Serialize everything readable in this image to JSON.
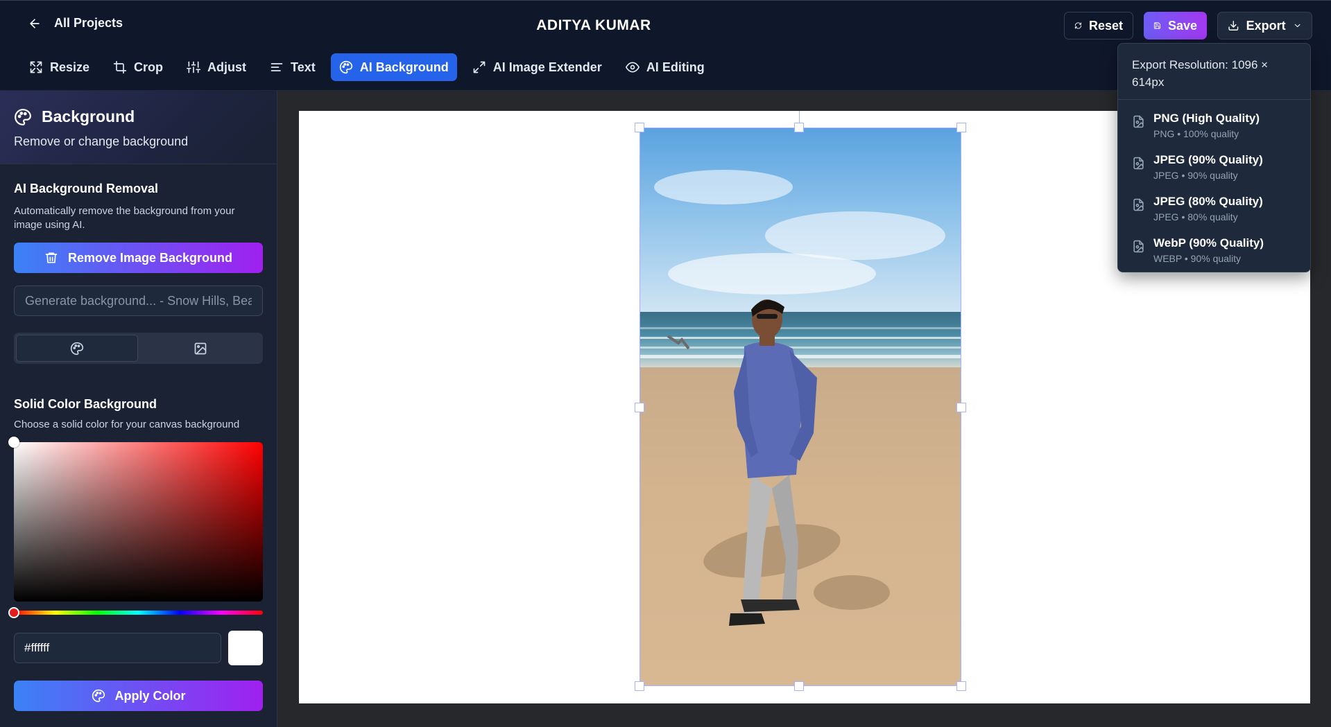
{
  "header": {
    "back_label": "All Projects",
    "project_title": "ADITYA KUMAR",
    "reset_label": "Reset",
    "save_label": "Save",
    "export_label": "Export"
  },
  "toolbar": {
    "tools": [
      {
        "label": "Resize",
        "icon": "resize-icon"
      },
      {
        "label": "Crop",
        "icon": "crop-icon"
      },
      {
        "label": "Adjust",
        "icon": "sliders-icon"
      },
      {
        "label": "Text",
        "icon": "text-icon"
      },
      {
        "label": "AI Background",
        "icon": "palette-icon",
        "active": true
      },
      {
        "label": "AI Image Extender",
        "icon": "expand-icon"
      },
      {
        "label": "AI Editing",
        "icon": "eye-icon"
      }
    ]
  },
  "sidebar": {
    "title": "Background",
    "subtitle": "Remove or change background",
    "removal": {
      "title": "AI Background Removal",
      "description": "Automatically remove the background from your image using AI.",
      "button_label": "Remove Image Background",
      "prompt_placeholder": "Generate background... - Snow Hills, Beach"
    },
    "solid": {
      "title": "Solid Color Background",
      "description": "Choose a solid color for your canvas background",
      "hex_value": "#ffffff",
      "swatch_color": "#ffffff",
      "apply_label": "Apply Color"
    }
  },
  "export_menu": {
    "resolution": "Export Resolution: 1096 × 614px",
    "options": [
      {
        "label": "PNG (High Quality)",
        "sub": "PNG • 100% quality"
      },
      {
        "label": "JPEG (90% Quality)",
        "sub": "JPEG • 90% quality"
      },
      {
        "label": "JPEG (80% Quality)",
        "sub": "JPEG • 80% quality"
      },
      {
        "label": "WebP (90% Quality)",
        "sub": "WEBP • 90% quality"
      }
    ]
  },
  "colors": {
    "accent": "#2563eb",
    "save_gradient": [
      "#6d5cf5",
      "#a338f0"
    ],
    "header_bg": "#0f172a",
    "sidebar_bg": "#1a2233"
  }
}
